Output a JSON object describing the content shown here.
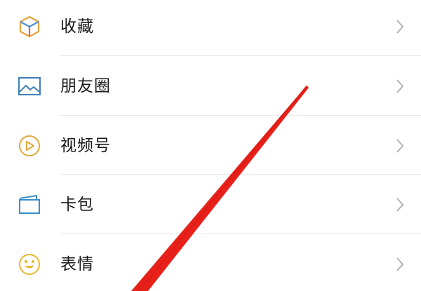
{
  "menu": {
    "items": [
      {
        "label": "收藏",
        "icon": "favorites-cube-icon"
      },
      {
        "label": "朋友圈",
        "icon": "moments-picture-icon"
      },
      {
        "label": "视频号",
        "icon": "channels-play-icon"
      },
      {
        "label": "卡包",
        "icon": "card-wallet-icon"
      },
      {
        "label": "表情",
        "icon": "sticker-smiley-icon"
      }
    ]
  },
  "colors": {
    "favorites_icon": "#e6a23c",
    "moments_icon": "#3f7fb8",
    "channels_icon": "#e0a83a",
    "cards_icon": "#3a8fc9",
    "sticker_icon": "#e9b62f",
    "chevron": "#b2b2b2",
    "divider": "#e6e6e6",
    "annotation_arrow": "#e8201a"
  }
}
